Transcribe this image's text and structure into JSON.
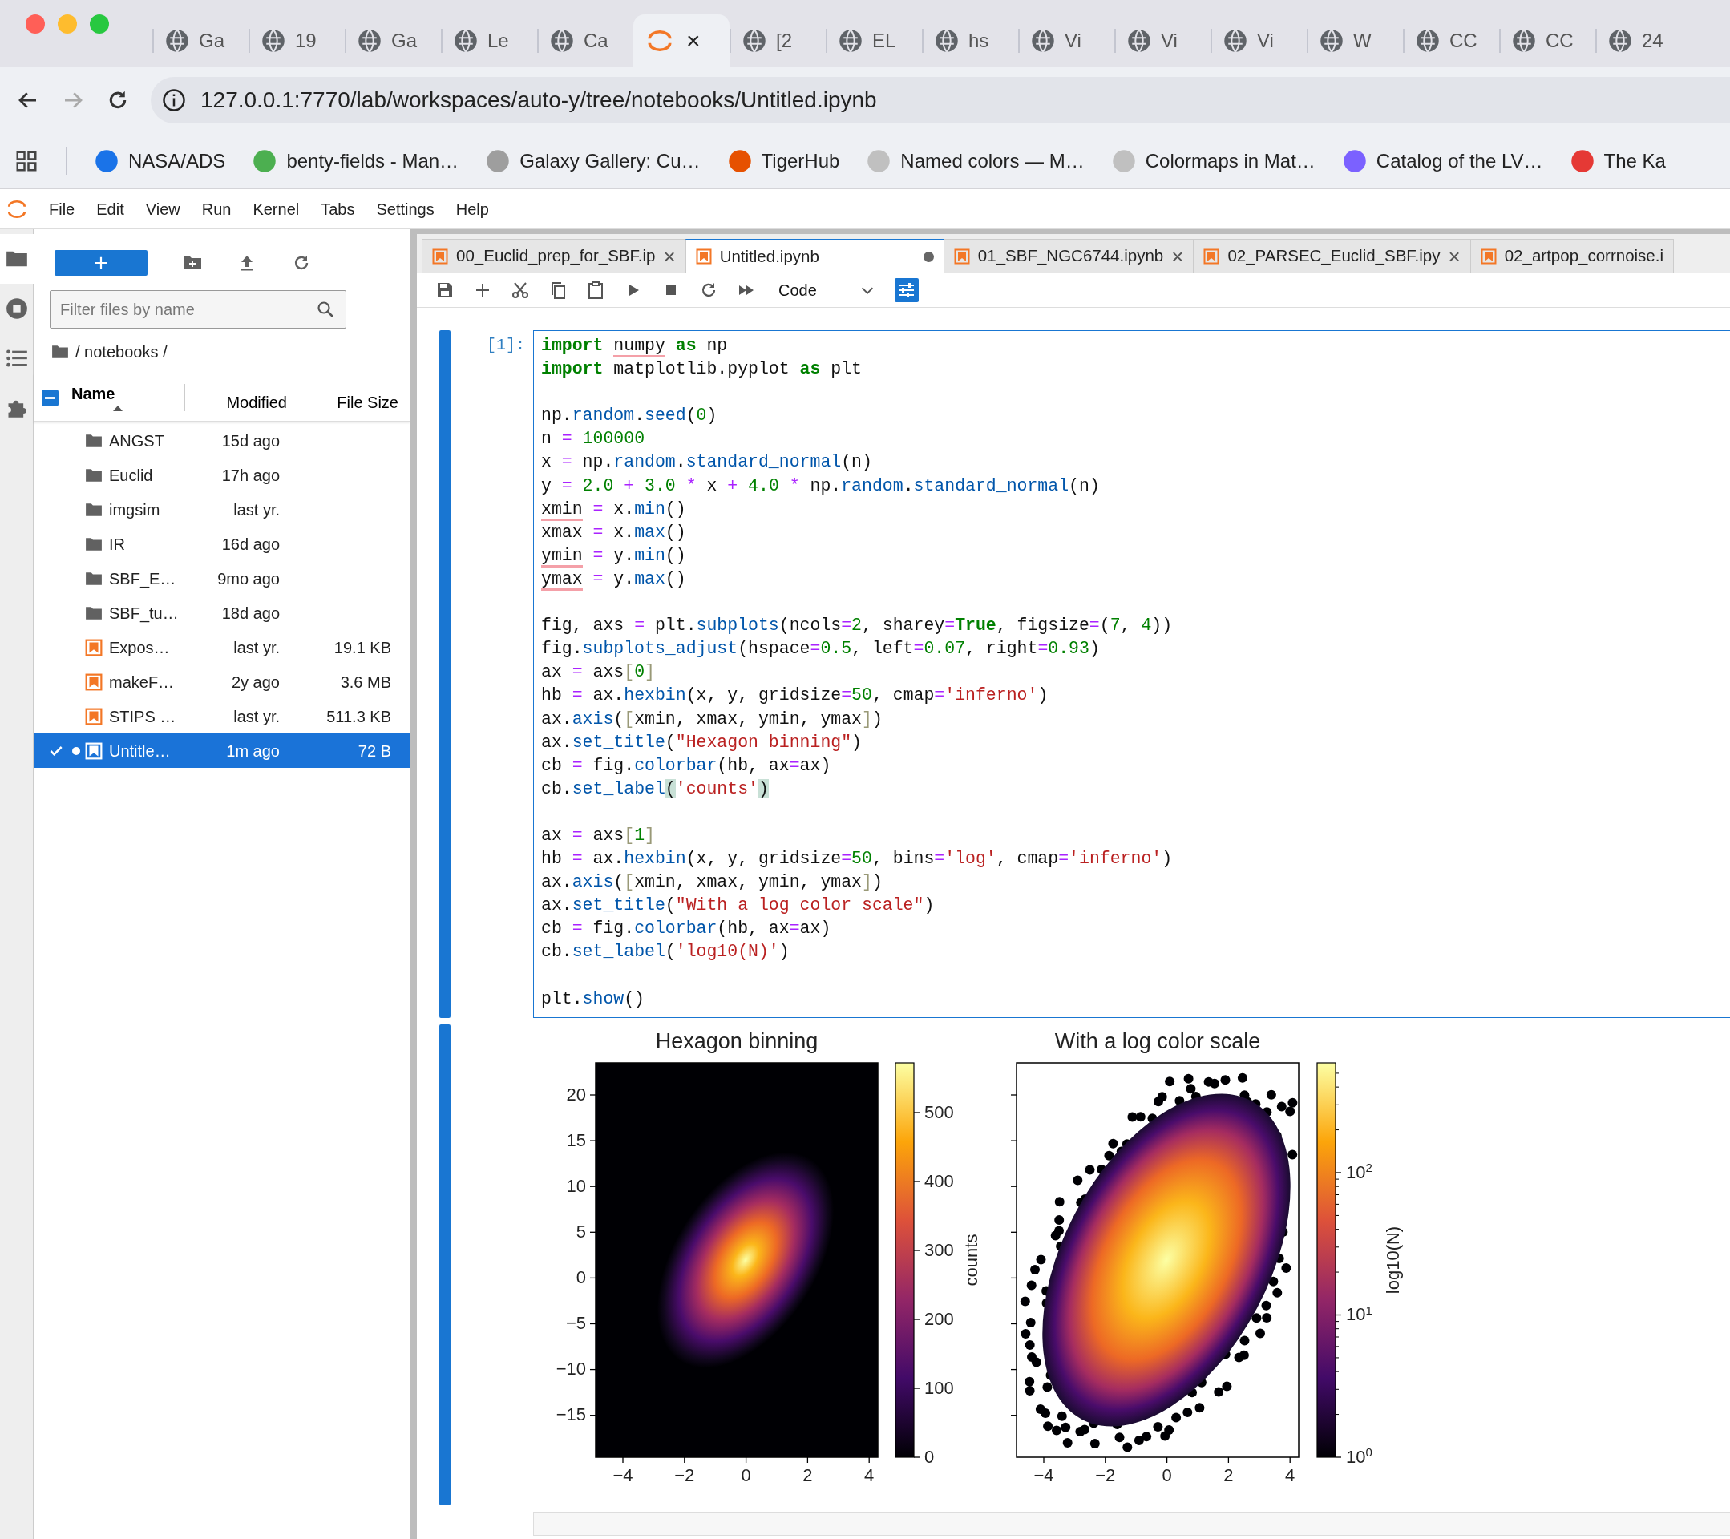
{
  "browser": {
    "tabs": [
      {
        "label": "Ga",
        "selected": false
      },
      {
        "label": "19",
        "selected": false
      },
      {
        "label": "Ga",
        "selected": false
      },
      {
        "label": "Le",
        "selected": false
      },
      {
        "label": "Ca",
        "selected": false
      },
      {
        "close": "×",
        "selected": true
      },
      {
        "label": "[2",
        "selected": false
      },
      {
        "label": "EL",
        "selected": false
      },
      {
        "label": "hs",
        "selected": false
      },
      {
        "label": "Vi",
        "selected": false
      },
      {
        "label": "Vi",
        "selected": false
      },
      {
        "label": "Vi",
        "selected": false
      },
      {
        "label": "W",
        "selected": false
      },
      {
        "label": "CC",
        "selected": false
      },
      {
        "label": "CC",
        "selected": false
      },
      {
        "label": "24",
        "selected": false
      }
    ],
    "address": "127.0.0.1:7770/lab/workspaces/auto-y/tree/notebooks/Untitled.ipynb",
    "bookmarks": [
      "NASA/ADS",
      "benty-fields - Man…",
      "Galaxy Gallery: Cu…",
      "TigerHub",
      "Named colors — M…",
      "Colormaps in Mat…",
      "Catalog of the LV…",
      "The Ka"
    ]
  },
  "menu": [
    "File",
    "Edit",
    "View",
    "Run",
    "Kernel",
    "Tabs",
    "Settings",
    "Help"
  ],
  "side_tabs": [
    {
      "kind": "files",
      "selected": true
    },
    {
      "kind": "running",
      "selected": false
    },
    {
      "kind": "toc",
      "selected": false
    },
    {
      "kind": "extensions",
      "selected": false
    }
  ],
  "file_browser": {
    "filter_placeholder": "Filter files by name",
    "path": "/ notebooks /",
    "select_all_partial": true,
    "columns": [
      {
        "label": "Name",
        "sorted": true,
        "descending": false
      },
      {
        "label": "Modified"
      },
      {
        "label": "File Size"
      }
    ],
    "rows": [
      {
        "kind": "folder",
        "name": "ANGST",
        "modified": "15d ago",
        "selected": false,
        "running": false
      },
      {
        "kind": "folder",
        "name": "Euclid",
        "modified": "17h ago",
        "selected": false,
        "running": false
      },
      {
        "kind": "folder",
        "name": "imgsim",
        "modified": "last yr.",
        "selected": false,
        "running": false
      },
      {
        "kind": "folder",
        "name": "IR",
        "modified": "16d ago",
        "selected": false,
        "running": false
      },
      {
        "kind": "folder",
        "name": "SBF_E…",
        "modified": "9mo ago",
        "selected": false,
        "running": false
      },
      {
        "kind": "folder",
        "name": "SBF_tu…",
        "modified": "18d ago",
        "selected": false,
        "running": false
      },
      {
        "kind": "notebook",
        "name": "Expos…",
        "modified": "last yr.",
        "size": "19.1 KB",
        "selected": false,
        "running": false
      },
      {
        "kind": "notebook",
        "name": "makeF…",
        "modified": "2y ago",
        "size": "3.6 MB",
        "selected": false,
        "running": false
      },
      {
        "kind": "notebook",
        "name": "STIPS …",
        "modified": "last yr.",
        "size": "511.3 KB",
        "selected": false,
        "running": false
      },
      {
        "kind": "notebook",
        "name": "Untitle…",
        "modified": "1m ago",
        "size": "72 B",
        "selected": true,
        "running": true
      }
    ]
  },
  "notebook_tabs": [
    {
      "label": "00_Euclid_prep_for_SBF.ip",
      "selected": false,
      "dirty": false,
      "close": "×"
    },
    {
      "label": "Untitled.ipynb",
      "selected": true,
      "dirty": true
    },
    {
      "label": "01_SBF_NGC6744.ipynb",
      "selected": false,
      "dirty": false,
      "close": "×"
    },
    {
      "label": "02_PARSEC_Euclid_SBF.ipy",
      "selected": false,
      "dirty": false,
      "close": "×"
    },
    {
      "label": "02_artpop_corrnoise.i",
      "selected": false,
      "dirty": false
    }
  ],
  "toolbar": {
    "cell_type": "Code"
  },
  "cell": {
    "prompt": "[1]:",
    "blocks": [
      [
        [
          {
            "kind": "kw",
            "text": "import "
          },
          {
            "kind": "flag",
            "text": "numpy"
          },
          {
            "kind": "kw",
            "text": " as"
          },
          {
            "kind": "plain",
            "text": " np"
          }
        ],
        [
          {
            "kind": "kw",
            "text": "import"
          },
          {
            "kind": "plain",
            "text": " matplotlib.pyplot "
          },
          {
            "kind": "kw",
            "text": "as"
          },
          {
            "kind": "plain",
            "text": " plt"
          }
        ]
      ],
      [
        [
          {
            "kind": "plain",
            "text": "np."
          },
          {
            "kind": "fn",
            "text": "random"
          },
          {
            "kind": "plain",
            "text": "."
          },
          {
            "kind": "fn",
            "text": "seed"
          },
          {
            "kind": "plain",
            "text": "("
          },
          {
            "kind": "num",
            "text": "0"
          },
          {
            "kind": "plain",
            "text": ")"
          }
        ],
        [
          {
            "kind": "plain",
            "text": "n "
          },
          {
            "kind": "op",
            "text": "="
          },
          {
            "kind": "num",
            "text": " 100000"
          }
        ],
        [
          {
            "kind": "plain",
            "text": "x "
          },
          {
            "kind": "op",
            "text": "="
          },
          {
            "kind": "plain",
            "text": " np."
          },
          {
            "kind": "fn",
            "text": "random"
          },
          {
            "kind": "plain",
            "text": "."
          },
          {
            "kind": "fn",
            "text": "standard_normal"
          },
          {
            "kind": "plain",
            "text": "(n)"
          }
        ],
        [
          {
            "kind": "plain",
            "text": "y "
          },
          {
            "kind": "op",
            "text": "="
          },
          {
            "kind": "num",
            "text": " 2.0 "
          },
          {
            "kind": "op",
            "text": "+"
          },
          {
            "kind": "num",
            "text": " 3.0 "
          },
          {
            "kind": "op",
            "text": "*"
          },
          {
            "kind": "plain",
            "text": " x "
          },
          {
            "kind": "op",
            "text": "+"
          },
          {
            "kind": "num",
            "text": " 4.0 "
          },
          {
            "kind": "op",
            "text": "*"
          },
          {
            "kind": "plain",
            "text": " np."
          },
          {
            "kind": "fn",
            "text": "random"
          },
          {
            "kind": "plain",
            "text": "."
          },
          {
            "kind": "fn",
            "text": "standard_normal"
          },
          {
            "kind": "plain",
            "text": "(n)"
          }
        ],
        [
          {
            "kind": "flag",
            "text": "xmin"
          },
          {
            "kind": "op",
            "text": " ="
          },
          {
            "kind": "plain",
            "text": " x."
          },
          {
            "kind": "fn",
            "text": "min"
          },
          {
            "kind": "plain",
            "text": "()"
          }
        ],
        [
          {
            "kind": "plain",
            "text": "xmax "
          },
          {
            "kind": "op",
            "text": "="
          },
          {
            "kind": "plain",
            "text": " x."
          },
          {
            "kind": "fn",
            "text": "max"
          },
          {
            "kind": "plain",
            "text": "()"
          }
        ],
        [
          {
            "kind": "flag",
            "text": "ymin"
          },
          {
            "kind": "op",
            "text": " ="
          },
          {
            "kind": "plain",
            "text": " y."
          },
          {
            "kind": "fn",
            "text": "min"
          },
          {
            "kind": "plain",
            "text": "()"
          }
        ],
        [
          {
            "kind": "flag",
            "text": "ymax"
          },
          {
            "kind": "op",
            "text": " ="
          },
          {
            "kind": "plain",
            "text": " y."
          },
          {
            "kind": "fn",
            "text": "max"
          },
          {
            "kind": "plain",
            "text": "()"
          }
        ]
      ],
      [
        [
          {
            "kind": "plain",
            "text": "fig, axs "
          },
          {
            "kind": "op",
            "text": "="
          },
          {
            "kind": "plain",
            "text": " plt."
          },
          {
            "kind": "fn",
            "text": "subplots"
          },
          {
            "kind": "plain",
            "text": "(ncols"
          },
          {
            "kind": "op",
            "text": "="
          },
          {
            "kind": "num",
            "text": "2"
          },
          {
            "kind": "plain",
            "text": ", sharey"
          },
          {
            "kind": "op",
            "text": "="
          },
          {
            "kind": "kw",
            "text": "True"
          },
          {
            "kind": "plain",
            "text": ", figsize"
          },
          {
            "kind": "op",
            "text": "="
          },
          {
            "kind": "plain",
            "text": "("
          },
          {
            "kind": "num",
            "text": "7"
          },
          {
            "kind": "plain",
            "text": ", "
          },
          {
            "kind": "num",
            "text": "4"
          },
          {
            "kind": "plain",
            "text": "))"
          }
        ],
        [
          {
            "kind": "plain",
            "text": "fig."
          },
          {
            "kind": "fn",
            "text": "subplots_adjust"
          },
          {
            "kind": "plain",
            "text": "(hspace"
          },
          {
            "kind": "op",
            "text": "="
          },
          {
            "kind": "num",
            "text": "0.5"
          },
          {
            "kind": "plain",
            "text": ", left"
          },
          {
            "kind": "op",
            "text": "="
          },
          {
            "kind": "num",
            "text": "0.07"
          },
          {
            "kind": "plain",
            "text": ", right"
          },
          {
            "kind": "op",
            "text": "="
          },
          {
            "kind": "num",
            "text": "0.93"
          },
          {
            "kind": "plain",
            "text": ")"
          }
        ],
        [
          {
            "kind": "plain",
            "text": "ax "
          },
          {
            "kind": "op",
            "text": "="
          },
          {
            "kind": "plain",
            "text": " axs"
          },
          {
            "kind": "br",
            "text": "["
          },
          {
            "kind": "num",
            "text": "0"
          },
          {
            "kind": "br",
            "text": "]"
          }
        ],
        [
          {
            "kind": "plain",
            "text": "hb "
          },
          {
            "kind": "op",
            "text": "="
          },
          {
            "kind": "plain",
            "text": " ax."
          },
          {
            "kind": "fn",
            "text": "hexbin"
          },
          {
            "kind": "plain",
            "text": "(x, y, gridsize"
          },
          {
            "kind": "op",
            "text": "="
          },
          {
            "kind": "num",
            "text": "50"
          },
          {
            "kind": "plain",
            "text": ", cmap"
          },
          {
            "kind": "op",
            "text": "="
          },
          {
            "kind": "str",
            "text": "'inferno'"
          },
          {
            "kind": "plain",
            "text": ")"
          }
        ],
        [
          {
            "kind": "plain",
            "text": "ax."
          },
          {
            "kind": "fn",
            "text": "axis"
          },
          {
            "kind": "plain",
            "text": "("
          },
          {
            "kind": "br",
            "text": "["
          },
          {
            "kind": "plain",
            "text": "xmin, xmax, ymin, ymax"
          },
          {
            "kind": "br",
            "text": "]"
          },
          {
            "kind": "plain",
            "text": ")"
          }
        ],
        [
          {
            "kind": "plain",
            "text": "ax."
          },
          {
            "kind": "fn",
            "text": "set_title"
          },
          {
            "kind": "plain",
            "text": "("
          },
          {
            "kind": "str",
            "text": "\"Hexagon binning\""
          },
          {
            "kind": "plain",
            "text": ")"
          }
        ],
        [
          {
            "kind": "plain",
            "text": "cb "
          },
          {
            "kind": "op",
            "text": "="
          },
          {
            "kind": "plain",
            "text": " fig."
          },
          {
            "kind": "fn",
            "text": "colorbar"
          },
          {
            "kind": "plain",
            "text": "(hb, ax"
          },
          {
            "kind": "op",
            "text": "="
          },
          {
            "kind": "plain",
            "text": "ax)"
          }
        ],
        [
          {
            "kind": "plain",
            "text": "cb."
          },
          {
            "kind": "fn",
            "text": "set_label"
          },
          {
            "kind": "match",
            "text": "("
          },
          {
            "kind": "str",
            "text": "'counts'"
          },
          {
            "kind": "match",
            "text": ")"
          }
        ]
      ],
      [
        [
          {
            "kind": "plain",
            "text": "ax "
          },
          {
            "kind": "op",
            "text": "="
          },
          {
            "kind": "plain",
            "text": " axs"
          },
          {
            "kind": "br",
            "text": "["
          },
          {
            "kind": "num",
            "text": "1"
          },
          {
            "kind": "br",
            "text": "]"
          }
        ],
        [
          {
            "kind": "plain",
            "text": "hb "
          },
          {
            "kind": "op",
            "text": "="
          },
          {
            "kind": "plain",
            "text": " ax."
          },
          {
            "kind": "fn",
            "text": "hexbin"
          },
          {
            "kind": "plain",
            "text": "(x, y, gridsize"
          },
          {
            "kind": "op",
            "text": "="
          },
          {
            "kind": "num",
            "text": "50"
          },
          {
            "kind": "plain",
            "text": ", bins"
          },
          {
            "kind": "op",
            "text": "="
          },
          {
            "kind": "str",
            "text": "'log'"
          },
          {
            "kind": "plain",
            "text": ", cmap"
          },
          {
            "kind": "op",
            "text": "="
          },
          {
            "kind": "str",
            "text": "'inferno'"
          },
          {
            "kind": "plain",
            "text": ")"
          }
        ],
        [
          {
            "kind": "plain",
            "text": "ax."
          },
          {
            "kind": "fn",
            "text": "axis"
          },
          {
            "kind": "plain",
            "text": "("
          },
          {
            "kind": "br",
            "text": "["
          },
          {
            "kind": "plain",
            "text": "xmin, xmax, ymin, ymax"
          },
          {
            "kind": "br",
            "text": "]"
          },
          {
            "kind": "plain",
            "text": ")"
          }
        ],
        [
          {
            "kind": "plain",
            "text": "ax."
          },
          {
            "kind": "fn",
            "text": "set_title"
          },
          {
            "kind": "plain",
            "text": "("
          },
          {
            "kind": "str",
            "text": "\"With a log color scale\""
          },
          {
            "kind": "plain",
            "text": ")"
          }
        ],
        [
          {
            "kind": "plain",
            "text": "cb "
          },
          {
            "kind": "op",
            "text": "="
          },
          {
            "kind": "plain",
            "text": " fig."
          },
          {
            "kind": "fn",
            "text": "colorbar"
          },
          {
            "kind": "plain",
            "text": "(hb, ax"
          },
          {
            "kind": "op",
            "text": "="
          },
          {
            "kind": "plain",
            "text": "ax)"
          }
        ],
        [
          {
            "kind": "plain",
            "text": "cb."
          },
          {
            "kind": "fn",
            "text": "set_label"
          },
          {
            "kind": "plain",
            "text": "("
          },
          {
            "kind": "str",
            "text": "'log10(N)'"
          },
          {
            "kind": "plain",
            "text": ")"
          }
        ]
      ],
      [
        [
          {
            "kind": "plain",
            "text": "plt."
          },
          {
            "kind": "fn",
            "text": "show"
          },
          {
            "kind": "plain",
            "text": "()"
          }
        ]
      ]
    ]
  },
  "output": {
    "plots": [
      {
        "title": "Hexagon binning",
        "kind": "linear",
        "yticks": [
          "20",
          "15",
          "10",
          "5",
          "0",
          "−5",
          "−10",
          "−15"
        ],
        "xticks": [
          "−4",
          "−2",
          "0",
          "2",
          "4"
        ],
        "colorbar_ticks": [
          "500",
          "400",
          "300",
          "200",
          "100",
          "0"
        ],
        "colorbar_label": "counts"
      },
      {
        "title": "With a log color scale",
        "kind": "log",
        "xticks": [
          "−4",
          "−2",
          "0",
          "2",
          "4"
        ],
        "colorbar_ticks": [
          "10$^{2}$",
          "10$^{1}$",
          "10$^{0}$"
        ],
        "colorbar_label": "log10(N)"
      }
    ]
  }
}
